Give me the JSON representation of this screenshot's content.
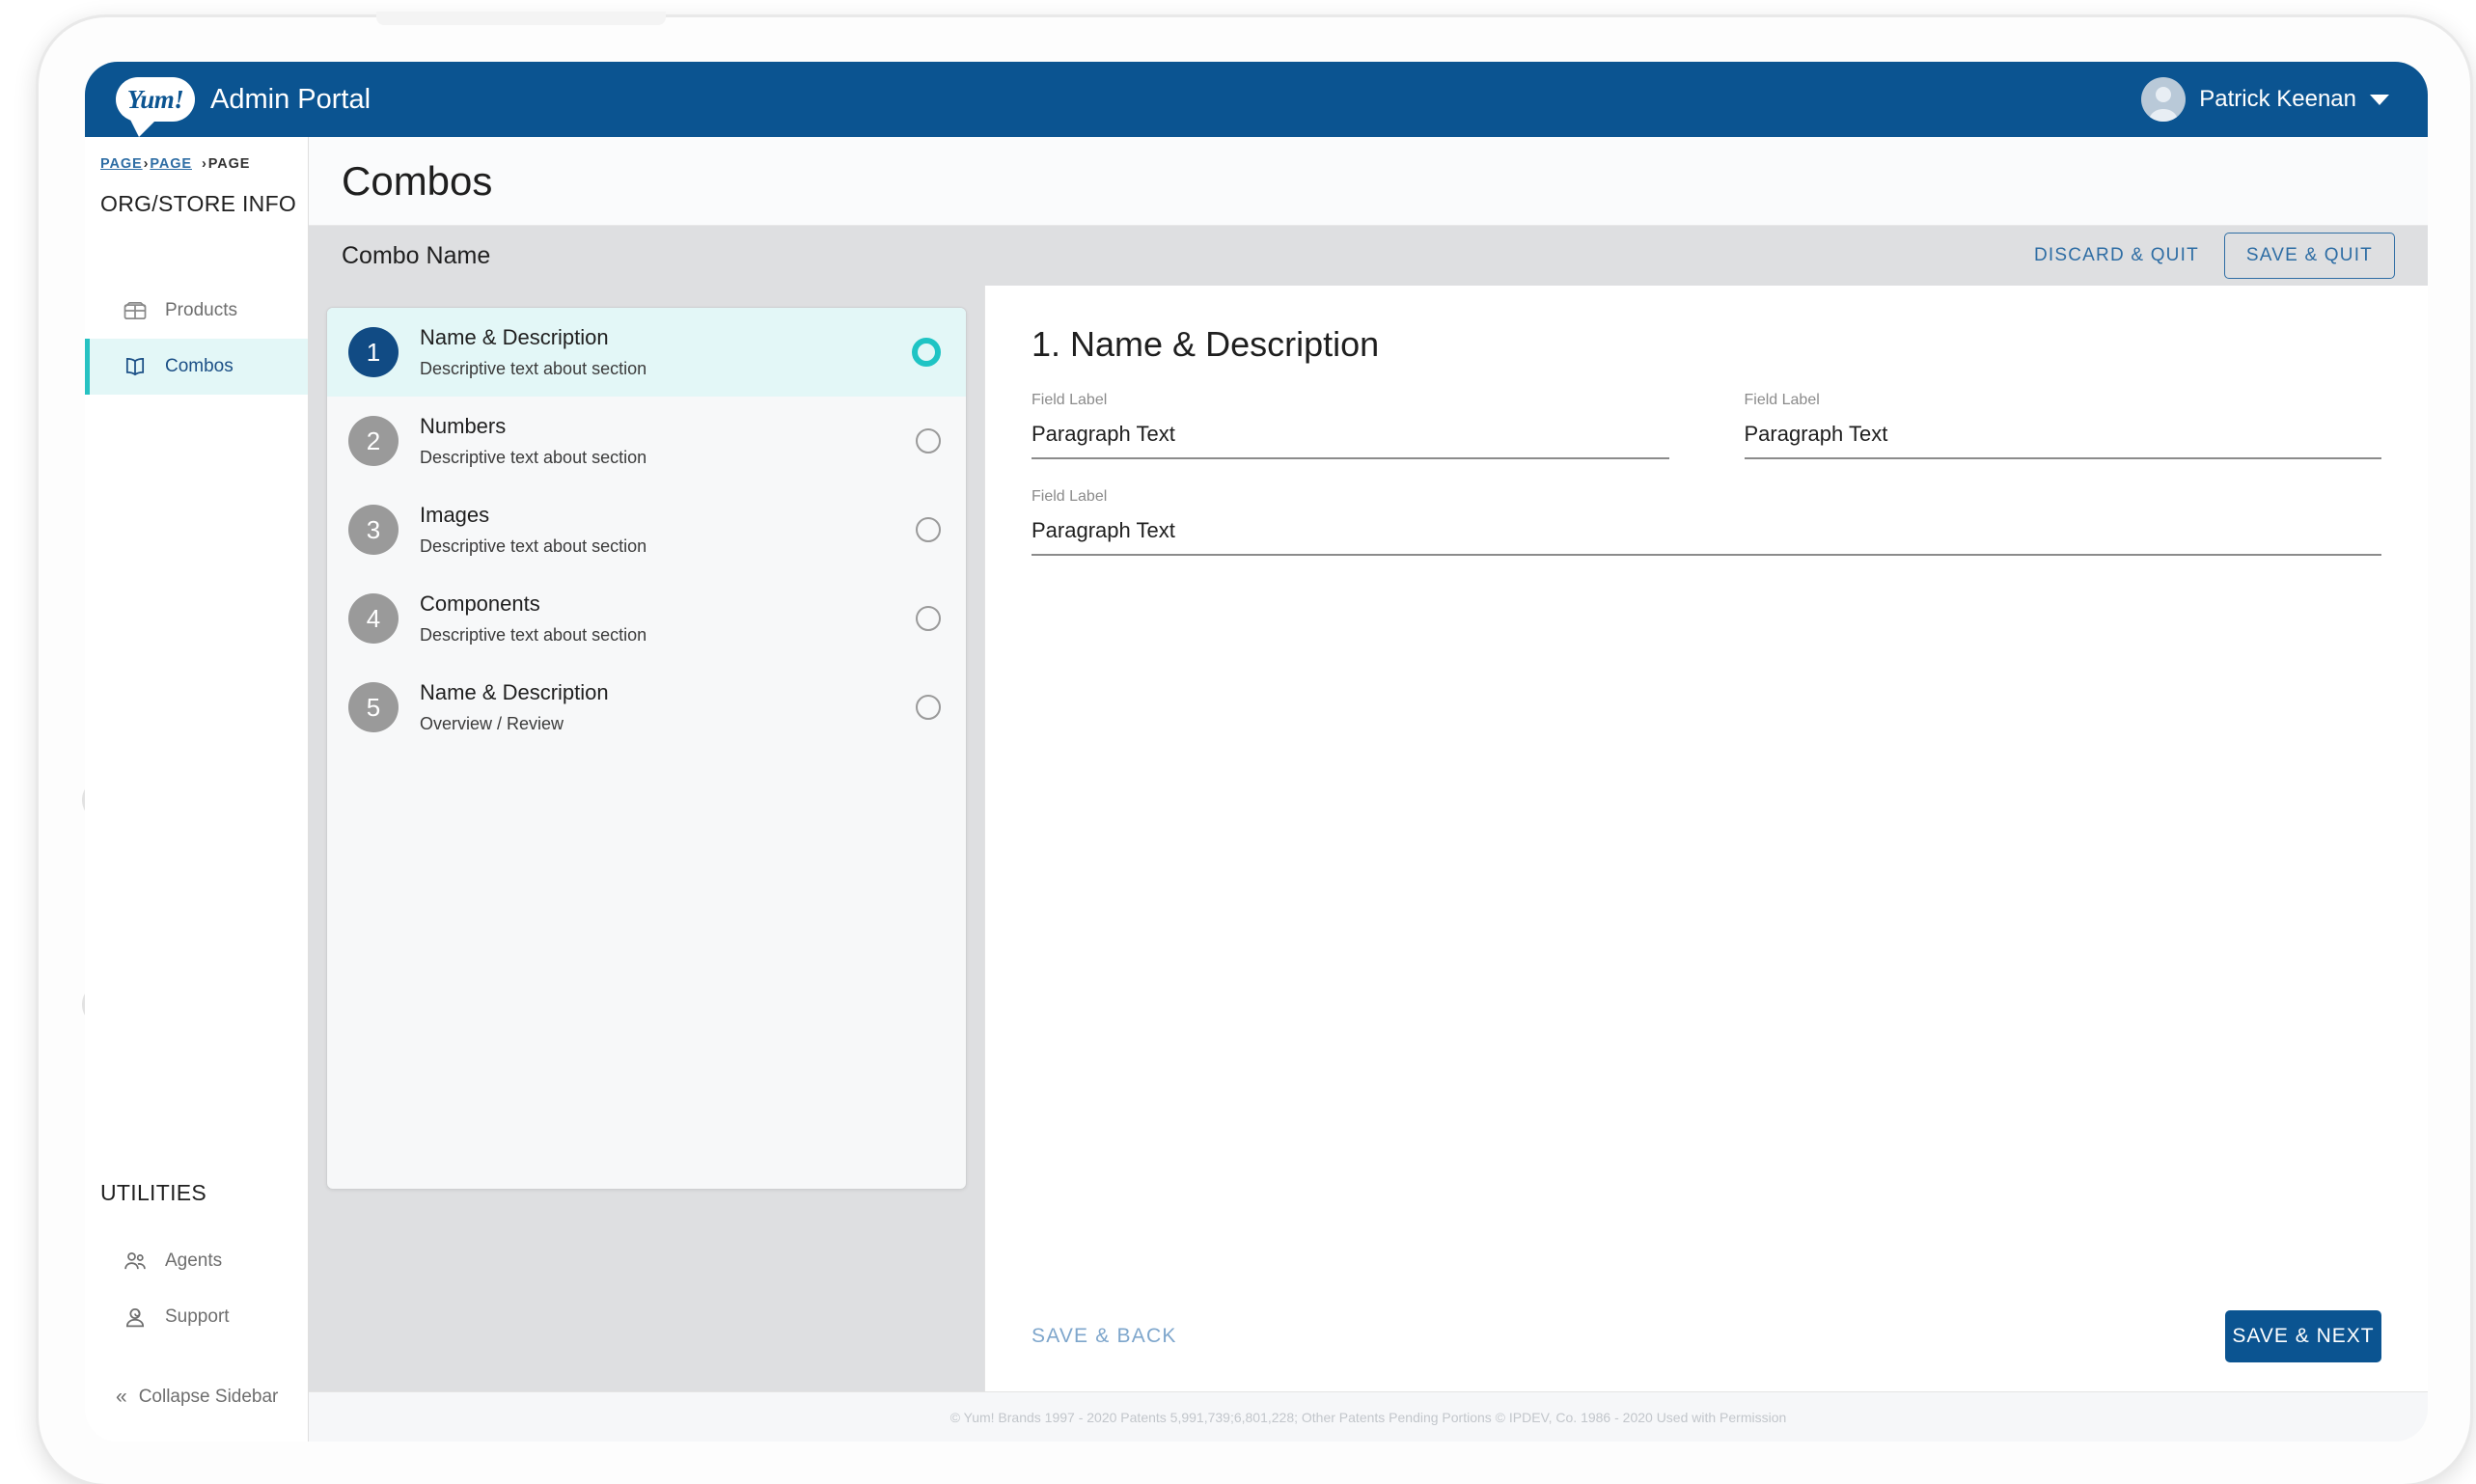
{
  "header": {
    "logo_text": "Yum!",
    "app_title": "Admin Portal",
    "user_name": "Patrick Keenan"
  },
  "sidebar": {
    "breadcrumb": {
      "item1": "PAGE",
      "sep1": "›",
      "item2": "PAGE",
      "sep2": "›",
      "item3": "PAGE"
    },
    "section_title": "ORG/STORE INFO",
    "items": [
      {
        "label": "Products",
        "icon": "package-icon",
        "active": false
      },
      {
        "label": "Combos",
        "icon": "book-icon",
        "active": true
      }
    ],
    "utilities_title": "UTILITIES",
    "utilities": [
      {
        "label": "Agents",
        "icon": "users-icon"
      },
      {
        "label": "Support",
        "icon": "support-agent-icon"
      }
    ],
    "collapse_label": "Collapse Sidebar",
    "collapse_icon": "chevron-double-left-icon"
  },
  "page": {
    "title": "Combos"
  },
  "action_bar": {
    "combo_name_label": "Combo Name",
    "discard_label": "DISCARD & QUIT",
    "save_quit_label": "SAVE & QUIT"
  },
  "stepper": {
    "steps": [
      {
        "number": "1",
        "title": "Name & Description",
        "subtitle": "Descriptive text about section",
        "active": true
      },
      {
        "number": "2",
        "title": "Numbers",
        "subtitle": "Descriptive text about section",
        "active": false
      },
      {
        "number": "3",
        "title": "Images",
        "subtitle": "Descriptive text about section",
        "active": false
      },
      {
        "number": "4",
        "title": "Components",
        "subtitle": "Descriptive text about section",
        "active": false
      },
      {
        "number": "5",
        "title": "Name & Description",
        "subtitle": "Overview / Review",
        "active": false
      }
    ]
  },
  "form": {
    "section_title": "1. Name & Description",
    "fields": [
      {
        "label": "Field Label",
        "value": "Paragraph Text",
        "width": "half"
      },
      {
        "label": "Field Label",
        "value": "Paragraph Text",
        "width": "half"
      },
      {
        "label": "Field Label",
        "value": "Paragraph Text",
        "width": "full"
      }
    ],
    "save_back_label": "SAVE & BACK",
    "save_next_label": "SAVE & NEXT"
  },
  "footer": {
    "copyright": "© Yum! Brands 1997 - 2020 Patents 5,991,739;6,801,228; Other Patents Pending Portions © IPDEV, Co. 1986 - 2020 Used with Permission"
  },
  "colors": {
    "brand_blue": "#0b5491",
    "accent_teal": "#1fc4c4",
    "link_blue": "#2e6da4",
    "action_bar_gray": "#dedfe1"
  }
}
